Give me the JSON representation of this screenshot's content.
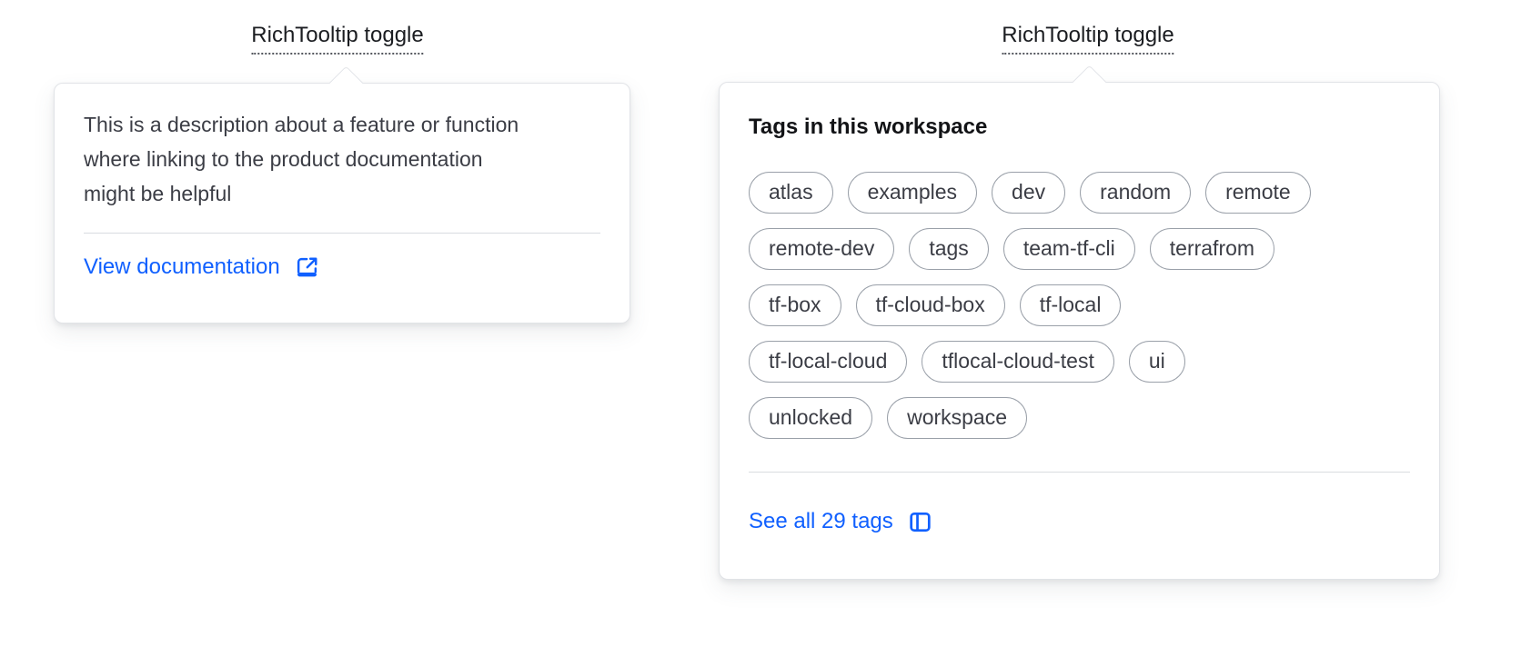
{
  "colors": {
    "accent_blue": "#1060ff",
    "text_primary": "#3b3d45",
    "text_strong": "#121316",
    "pill_border": "#9aa0a9",
    "card_border": "#e1e3e7"
  },
  "left_tooltip": {
    "toggle_label": "RichTooltip toggle",
    "description": "This is a description about a feature or function where linking to the product documentation might be helpful",
    "link_label": "View documentation",
    "link_icon": "docs-link-icon"
  },
  "right_tooltip": {
    "toggle_label": "RichTooltip toggle",
    "heading": "Tags in this workspace",
    "tag_rows": [
      [
        "atlas",
        "examples",
        "dev",
        "random",
        "remote"
      ],
      [
        "remote-dev",
        "tags",
        "team-tf-cli",
        "terrafrom"
      ],
      [
        "tf-box",
        "tf-cloud-box",
        "tf-local"
      ],
      [
        "tf-local-cloud",
        "tflocal-cloud-test",
        "ui"
      ],
      [
        "unlocked",
        "workspace"
      ]
    ],
    "link_label": "See all 29 tags",
    "link_icon": "sidebar-icon"
  }
}
